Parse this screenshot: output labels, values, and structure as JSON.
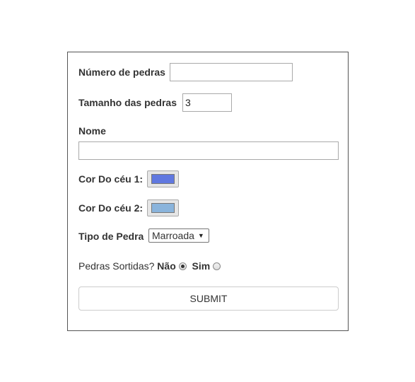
{
  "form": {
    "num_pedras_label": "Número de pedras",
    "num_pedras_value": "",
    "tamanho_label": "Tamanho das pedras",
    "tamanho_value": "3",
    "nome_label": "Nome",
    "nome_value": "",
    "cor_ceu1_label": "Cor Do céu 1:",
    "cor_ceu1_color": "#6078e0",
    "cor_ceu2_label": "Cor Do céu 2:",
    "cor_ceu2_color": "#8ab4dc",
    "tipo_pedra_label": "Tipo de Pedra",
    "tipo_pedra_selected": "Marroada",
    "sortidas_label": "Pedras Sortidas?",
    "radio_nao_label": "Não",
    "radio_nao_checked": true,
    "radio_sim_label": "Sim",
    "radio_sim_checked": false,
    "submit_label": "Submit"
  }
}
